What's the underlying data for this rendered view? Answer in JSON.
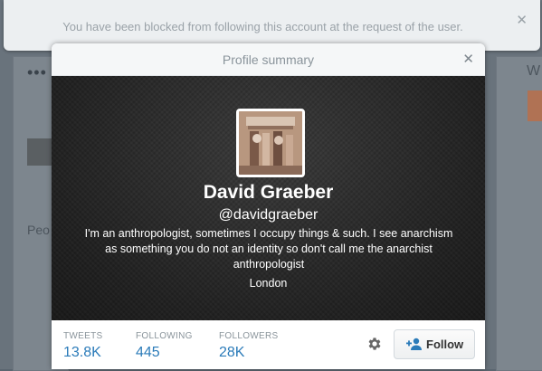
{
  "notice": {
    "message": "You have been blocked from following this account at the request of the user."
  },
  "modal": {
    "title": "Profile summary"
  },
  "profile": {
    "name": "David Graeber",
    "handle": "@davidgraeber",
    "bio": "I'm an anthropologist, sometimes I occupy things & such. I see anarchism as something you do not an identity so don't call me the anarchist anthropologist",
    "location": "London"
  },
  "stats": [
    {
      "label": "TWEETS",
      "value": "13.8K"
    },
    {
      "label": "FOLLOWING",
      "value": "445"
    },
    {
      "label": "FOLLOWERS",
      "value": "28K"
    }
  ],
  "actions": {
    "follow_label": "Follow",
    "settings_icon": "gear-icon"
  },
  "colors": {
    "accent": "#2b7bb9",
    "header_bg": "#222222"
  }
}
